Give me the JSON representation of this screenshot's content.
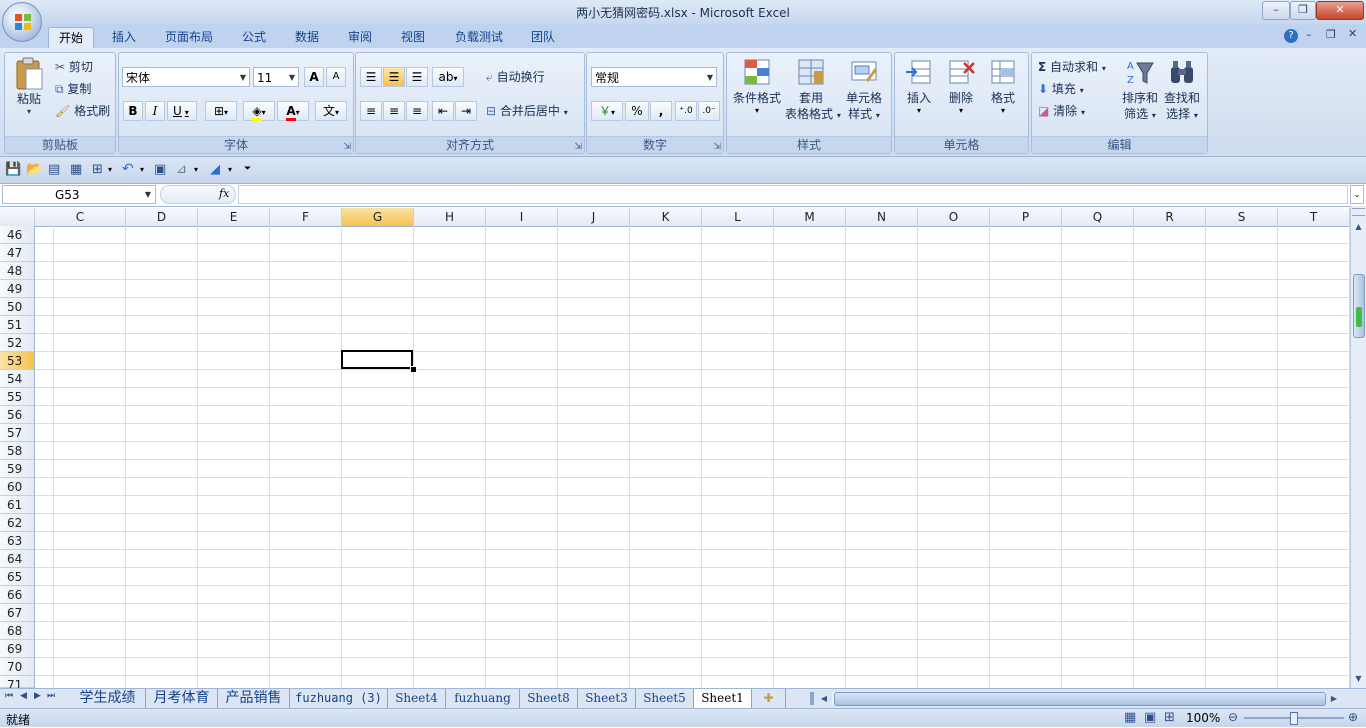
{
  "window": {
    "title": "两小无猜网密码.xlsx - Microsoft Excel",
    "minimize": "–",
    "restore": "❐",
    "close": "✕"
  },
  "tabs": [
    "开始",
    "插入",
    "页面布局",
    "公式",
    "数据",
    "审阅",
    "视图",
    "负载测试",
    "团队"
  ],
  "ribbon": {
    "clipboard": {
      "label": "剪贴板",
      "paste": "粘贴",
      "cut": "剪切",
      "copy": "复制",
      "format_painter": "格式刷"
    },
    "font": {
      "label": "字体",
      "font_name": "宋体",
      "font_size": "11",
      "bold": "B",
      "italic": "I",
      "underline": "U",
      "grow": "A",
      "shrink": "A",
      "color_a": "A",
      "wen": "文"
    },
    "alignment": {
      "label": "对齐方式",
      "wrap": "自动换行",
      "merge": "合并后居中"
    },
    "number": {
      "label": "数字",
      "format": "常规",
      "percent": "%",
      "comma": ","
    },
    "styles": {
      "label": "样式",
      "conditional": "条件格式",
      "table_1": "套用",
      "table_2": "表格格式",
      "cell_1": "单元格",
      "cell_2": "样式"
    },
    "cells": {
      "label": "单元格",
      "insert": "插入",
      "delete": "删除",
      "format": "格式"
    },
    "editing": {
      "label": "编辑",
      "autosum": "自动求和",
      "fill": "填充",
      "clear": "清除",
      "sort_1": "排序和",
      "sort_2": "筛选",
      "find_1": "查找和",
      "find_2": "选择"
    }
  },
  "formula_bar": {
    "name_box": "G53",
    "fx": "fx",
    "value": ""
  },
  "grid": {
    "columns": [
      "C",
      "D",
      "E",
      "F",
      "G",
      "H",
      "I",
      "J",
      "K",
      "L",
      "M",
      "N",
      "O",
      "P",
      "Q",
      "R",
      "S",
      "T"
    ],
    "selected_column": "G",
    "rows": [
      "46",
      "47",
      "48",
      "49",
      "50",
      "51",
      "52",
      "53",
      "54",
      "55",
      "56",
      "57",
      "58",
      "59",
      "60",
      "61",
      "62",
      "63",
      "64",
      "65",
      "66",
      "67",
      "68",
      "69",
      "70",
      "71"
    ],
    "selected_row": "53"
  },
  "sheets": [
    "学生成绩",
    "月考体育",
    "产品销售",
    "fuzhuang (3)",
    "Sheet4",
    "fuzhuang",
    "Sheet8",
    "Sheet3",
    "Sheet5",
    "Sheet1"
  ],
  "active_sheet": "Sheet1",
  "status": {
    "ready": "就绪",
    "zoom": "100%"
  },
  "colors": {
    "accent": "#15428b",
    "selected_header": "#f6c24f",
    "ribbon_bg": "#dbe6f4"
  }
}
